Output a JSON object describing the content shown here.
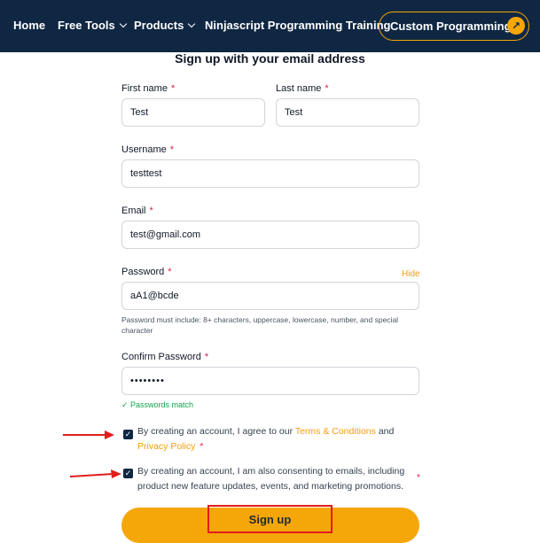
{
  "nav": {
    "items": [
      {
        "label": "Home"
      },
      {
        "label": "Free Tools"
      },
      {
        "label": "Products"
      },
      {
        "label": "Ninjascript Programming Training"
      }
    ],
    "cta_label": "Custom Programming",
    "cta_icon": "arrow-up-right-icon"
  },
  "form": {
    "heading": "Sign up with your email address",
    "first_name_label": "First name",
    "first_name_value": "Test",
    "last_name_label": "Last name",
    "last_name_value": "Test",
    "username_label": "Username",
    "username_value": "testtest",
    "email_label": "Email",
    "email_value": "test@gmail.com",
    "password_label": "Password",
    "password_toggle": "Hide",
    "password_value": "aA1@bcde",
    "password_hint": "Password must include: 8+ characters, uppercase, lowercase, number, and special character",
    "confirm_label": "Confirm Password",
    "confirm_value": "••••••••",
    "match_text": "✓ Passwords match",
    "required_mark": "*",
    "terms_prefix": "By creating an account, I agree to our",
    "terms_link": "Terms & Conditions",
    "terms_and": "and",
    "privacy_link": "Privacy Policy",
    "consent_line1": "By creating an account, I am also consenting to emails, including",
    "consent_line2": "product new feature updates, events, and marketing promotions.",
    "submit_label": "Sign up"
  },
  "colors": {
    "nav_bg": "#0f2742",
    "accent": "#f5a70a",
    "annotation": "#e11d1d"
  }
}
